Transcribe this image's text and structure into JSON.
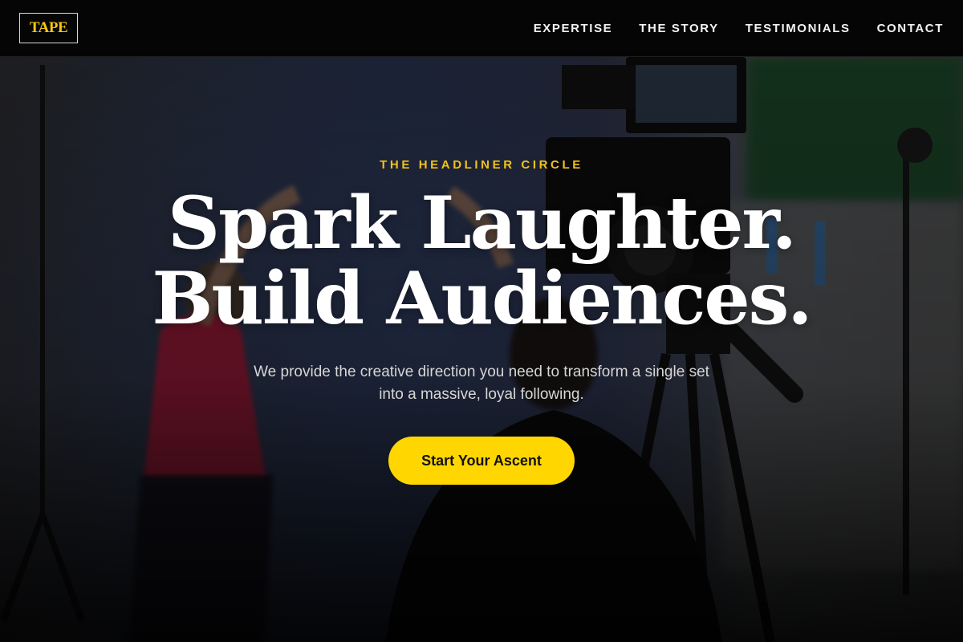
{
  "brand": {
    "logo_text": "TAPE",
    "accent": "#f5c518"
  },
  "nav": {
    "items": [
      {
        "label": "EXPERTISE"
      },
      {
        "label": "THE STORY"
      },
      {
        "label": "TESTIMONIALS"
      },
      {
        "label": "CONTACT"
      }
    ]
  },
  "hero": {
    "eyebrow": "THE HEADLINER CIRCLE",
    "headline_line1": "Spark Laughter.",
    "headline_line2": "Build Audiences.",
    "subtext_line1": "We provide the creative direction you need to transform a single set",
    "subtext_line2": "into a massive, loyal following.",
    "cta_label": "Start Your Ascent",
    "cta_color": "#ffd600",
    "background_image": "film-set-photo"
  }
}
